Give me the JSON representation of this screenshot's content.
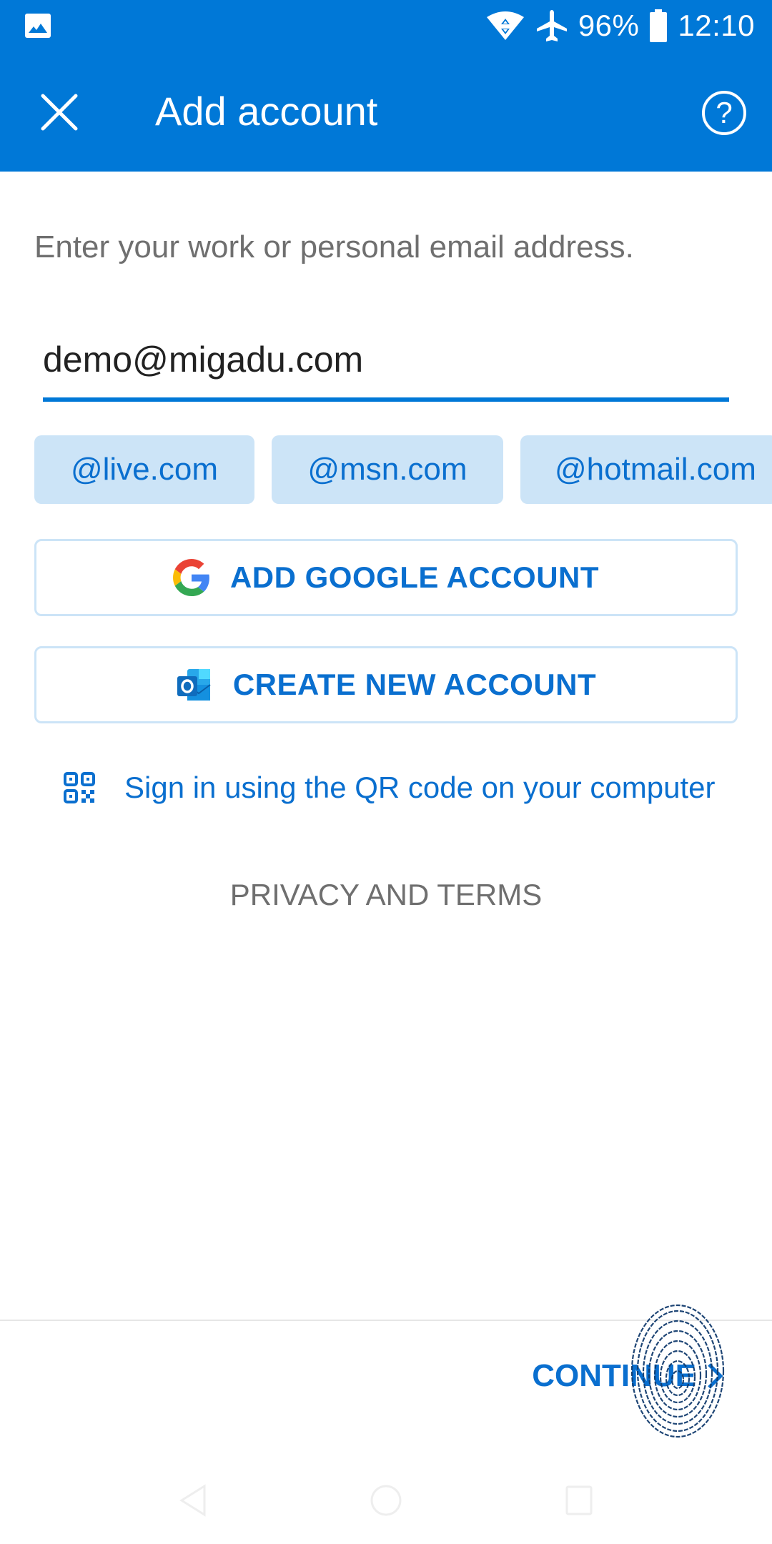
{
  "status_bar": {
    "notification_icon": "gallery-icon",
    "wifi_icon": "wifi-data-icon",
    "airplane_icon": "airplane-icon",
    "battery_percent": "96%",
    "battery_icon": "battery-icon",
    "time": "12:10"
  },
  "app_bar": {
    "close_icon": "close-icon",
    "title": "Add account",
    "help_icon": "help-icon",
    "help_glyph": "?"
  },
  "form": {
    "prompt": "Enter your work or personal email address.",
    "email_value": "demo@migadu.com",
    "domain_chips": [
      "@live.com",
      "@msn.com",
      "@hotmail.com"
    ]
  },
  "buttons": {
    "google": {
      "label": "ADD GOOGLE ACCOUNT",
      "icon": "google-icon"
    },
    "create": {
      "label": "CREATE NEW ACCOUNT",
      "icon": "outlook-icon"
    },
    "qr": {
      "label": "Sign in using the QR code on your computer",
      "icon": "qr-code-icon"
    },
    "privacy": "PRIVACY AND TERMS",
    "continue": {
      "label": "CONTINUE",
      "icon": "chevron-right-icon"
    }
  },
  "nav_bar": {
    "back": "back-icon",
    "home": "home-icon",
    "recents": "recents-icon"
  },
  "colors": {
    "brand": "#0078d7",
    "link": "#0a6fcf",
    "chip_bg": "#cce4f7",
    "muted_text": "#6f6f6f"
  }
}
